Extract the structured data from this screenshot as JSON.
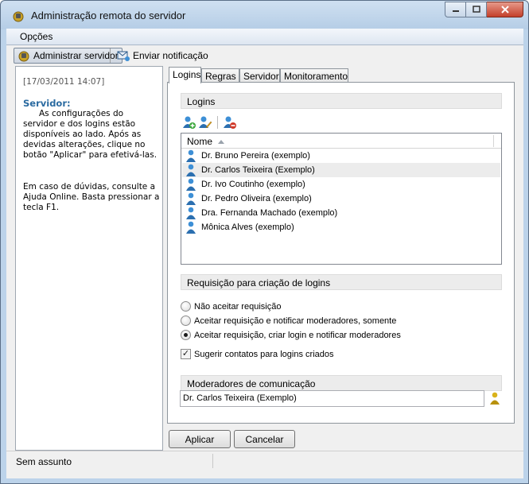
{
  "window": {
    "title": "Administração remota do servidor"
  },
  "menu": {
    "options_label": "Opções"
  },
  "toolbar": {
    "admin_label": "Administrar servidor",
    "notify_label": "Enviar notificação"
  },
  "info_panel": {
    "date": "[17/03/2011 14:07]",
    "heading": "Servidor:",
    "paragraph1": "As configurações do servidor e dos logins estão disponíveis ao lado. Após as devidas alterações, clique no botão \"Aplicar\" para efetivá-las.",
    "paragraph2": "Em caso de dúvidas, consulte a Ajuda Online. Basta pressionar a tecla F1."
  },
  "tabs": [
    "Logins",
    "Regras",
    "Servidor",
    "Monitoramento"
  ],
  "logins": {
    "section_title": "Logins",
    "column_name": "Nome",
    "items": [
      "Dr. Bruno Pereira (exemplo)",
      "Dr. Carlos Teixeira (Exemplo)",
      "Dr. Ivo Coutinho (exemplo)",
      "Dr. Pedro Oliveira (exemplo)",
      "Dra. Fernanda Machado (exemplo)",
      "Mônica Alves (exemplo)"
    ]
  },
  "request": {
    "section_title": "Requisição para criação de logins",
    "options": [
      "Não aceitar requisição",
      "Aceitar requisição e notificar moderadores, somente",
      "Aceitar requisição, criar login e notificar moderadores"
    ],
    "selected_index": 2,
    "suggest_label": "Sugerir contatos para logins criados",
    "suggest_checked": true
  },
  "moderators": {
    "section_title": "Moderadores de comunicação",
    "value": "Dr. Carlos Teixeira (Exemplo)"
  },
  "buttons": {
    "apply": "Aplicar",
    "cancel": "Cancelar"
  },
  "status": {
    "text": "Sem assunto"
  },
  "colors": {
    "accent": "#2a6aa0",
    "user_icon": "#2b7bc0",
    "mod_icon": "#d9b21a"
  }
}
